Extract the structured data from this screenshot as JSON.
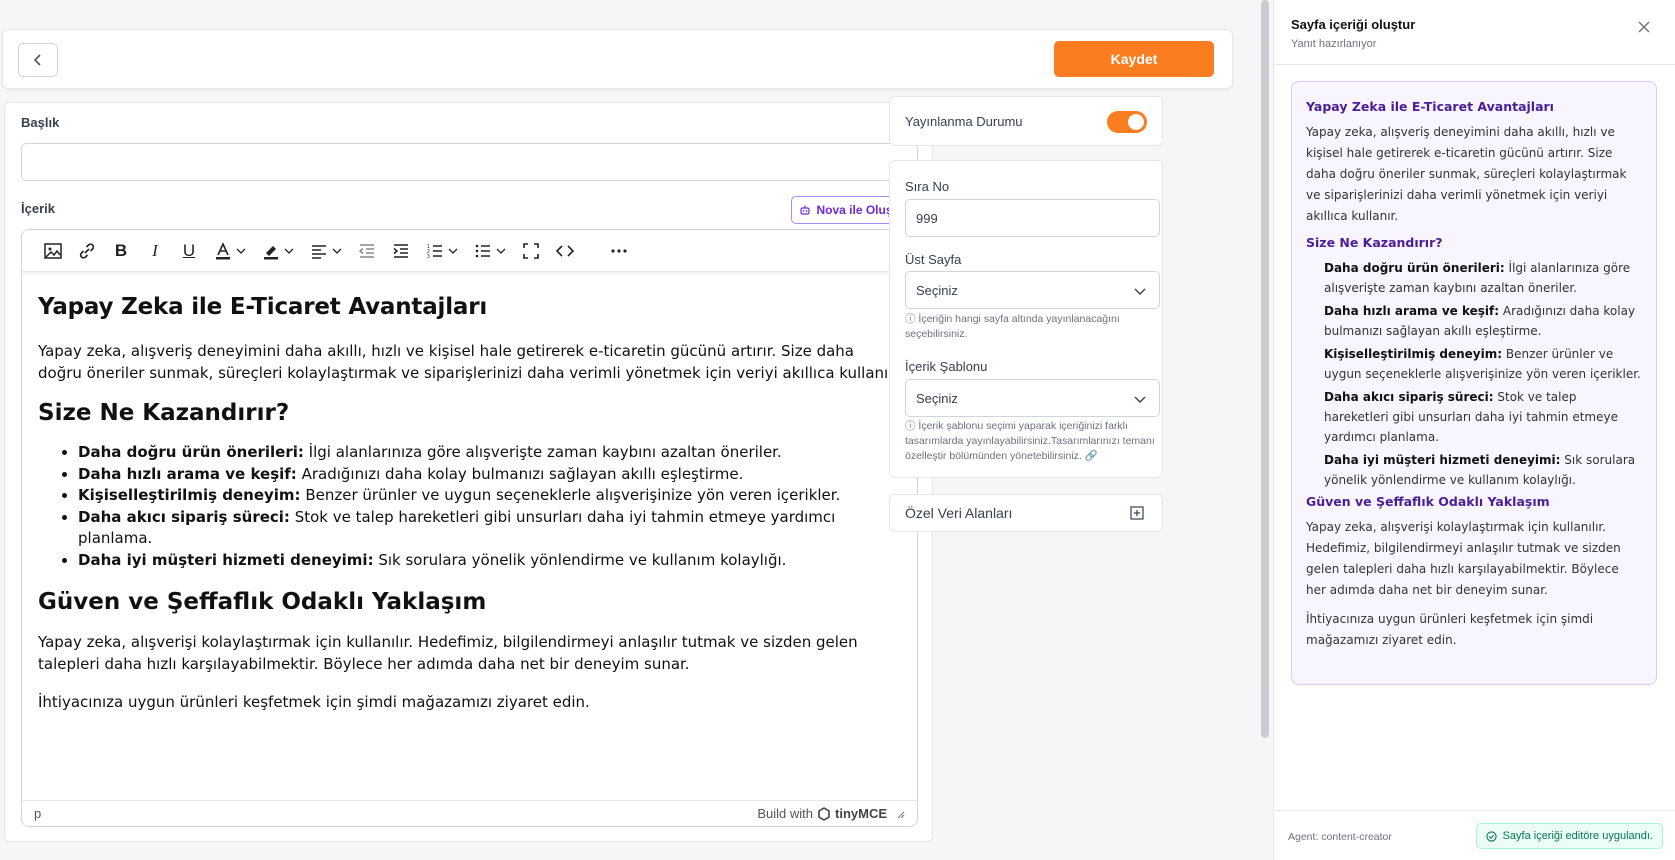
{
  "header": {
    "save_label": "Kaydet"
  },
  "form": {
    "title_label": "Başlık",
    "title_value": "",
    "content_label": "İçerik",
    "nova_button": "Nova ile Oluştur"
  },
  "editor": {
    "content": {
      "h1": "Yapay Zeka ile E-Ticaret Avantajları",
      "p1": "Yapay zeka, alışveriş deneyimini daha akıllı, hızlı ve kişisel hale getirerek e-ticaretin gücünü artırır. Size daha doğru öneriler sunmak, süreçleri kolaylaştırmak ve siparişlerinizi daha verimli yönetmek için veriyi akıllıca kullanır.",
      "h2": "Size Ne Kazandırır?",
      "benefits": [
        {
          "title": "Daha doğru ürün önerileri:",
          "text": "İlgi alanlarınıza göre alışverişte zaman kaybını azaltan öneriler."
        },
        {
          "title": "Daha hızlı arama ve keşif:",
          "text": "Aradığınızı daha kolay bulmanızı sağlayan akıllı eşleştirme."
        },
        {
          "title": "Kişiselleştirilmiş deneyim:",
          "text": "Benzer ürünler ve uygun seçeneklerle alışverişinize yön veren içerikler."
        },
        {
          "title": "Daha akıcı sipariş süreci:",
          "text": "Stok ve talep hareketleri gibi unsurları daha iyi tahmin etmeye yardımcı planlama."
        },
        {
          "title": "Daha iyi müşteri hizmeti deneyimi:",
          "text": "Sık sorulara yönelik yönlendirme ve kullanım kolaylığı."
        }
      ],
      "h3": "Güven ve Şeffaflık Odaklı Yaklaşım",
      "p2": "Yapay zeka, alışverişi kolaylaştırmak için kullanılır. Hedefimiz, bilgilendirmeyi anlaşılır tutmak ve sizden gelen talepleri daha hızlı karşılayabilmektir. Böylece her adımda daha net bir deneyim sunar.",
      "p3": "İhtiyacınıza uygun ürünleri keşfetmek için şimdi mağazamızı ziyaret edin."
    },
    "status_path": "p",
    "brand_prefix": "Build with",
    "brand_name": "tinyMCE"
  },
  "sidebar": {
    "publish_label": "Yayınlanma Durumu",
    "publish_on": true,
    "order_label": "Sıra No",
    "order_value": "999",
    "parent_label": "Üst Sayfa",
    "parent_value": "Seçiniz",
    "parent_hint": "İçeriğin hangi sayfa altında yayınlanacağını seçebilirsiniz.",
    "template_label": "İçerik Şablonu",
    "template_value": "Seçiniz",
    "template_hint": "İçerik şablonu seçimi yaparak içeriğinizi farklı tasarımlarda yayınlayabilirsiniz.Tasarımlarınızı temanı özelleştir bölümünden yönetebilirsiniz.",
    "custom_fields_label": "Özel Veri Alanları"
  },
  "panel": {
    "title": "Sayfa içeriği oluştur",
    "subtitle": "Yanıt hazırlanıyor",
    "response": {
      "h1": "Yapay Zeka ile E-Ticaret Avantajları",
      "p1": "Yapay zeka, alışveriş deneyimini daha akıllı, hızlı ve kişisel hale getirerek e-ticaretin gücünü artırır. Size daha doğru öneriler sunmak, süreçleri kolaylaştırmak ve siparişlerinizi daha verimli yönetmek için veriyi akıllıca kullanır.",
      "h2": "Size Ne Kazandırır?",
      "benefits": [
        {
          "title": "Daha doğru ürün önerileri:",
          "text": "İlgi alanlarınıza göre alışverişte zaman kaybını azaltan öneriler."
        },
        {
          "title": "Daha hızlı arama ve keşif:",
          "text": "Aradığınızı daha kolay bulmanızı sağlayan akıllı eşleştirme."
        },
        {
          "title": "Kişiselleştirilmiş deneyim:",
          "text": "Benzer ürünler ve uygun seçeneklerle alışverişinize yön veren içerikler."
        },
        {
          "title": "Daha akıcı sipariş süreci:",
          "text": "Stok ve talep hareketleri gibi unsurları daha iyi tahmin etmeye yardımcı planlama."
        },
        {
          "title": "Daha iyi müşteri hizmeti deneyimi:",
          "text": "Sık sorulara yönelik yönlendirme ve kullanım kolaylığı."
        }
      ],
      "h3": "Güven ve Şeffaflık Odaklı Yaklaşım",
      "p2": "Yapay zeka, alışverişi kolaylaştırmak için kullanılır. Hedefimiz, bilgilendirmeyi anlaşılır tutmak ve sizden gelen talepleri daha hızlı karşılayabilmektir. Böylece her adımda daha net bir deneyim sunar.",
      "p3": "İhtiyacınıza uygun ürünleri keşfetmek için şimdi mağazamızı ziyaret edin."
    },
    "agent_label": "Agent: content-creator",
    "applied_label": "Sayfa içeriği editöre uygulandı."
  },
  "colors": {
    "accent": "#fb7d1f",
    "ai_purple": "#6d28d9",
    "success": "#047857"
  }
}
